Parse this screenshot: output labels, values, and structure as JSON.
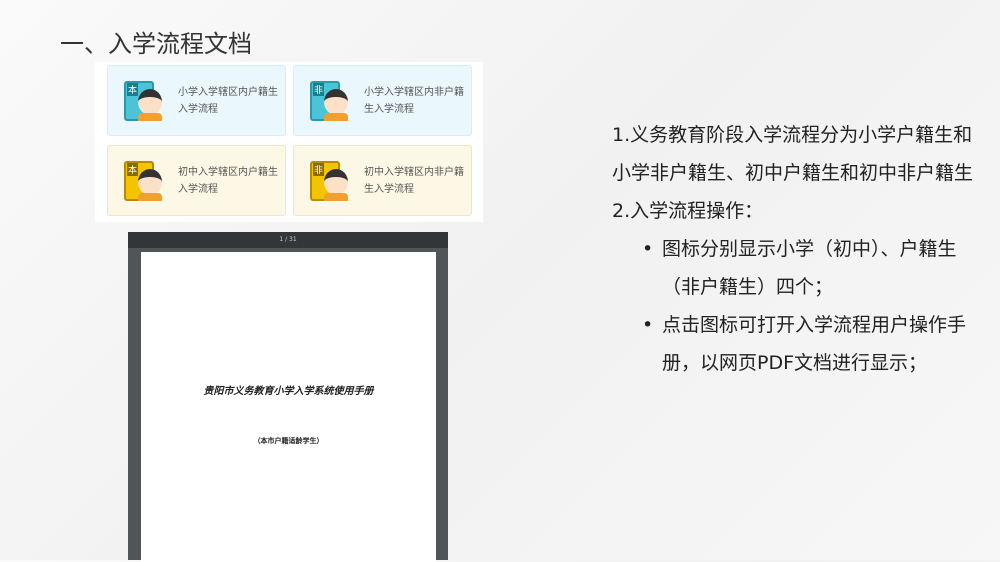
{
  "title": "一、入学流程文档",
  "cards": [
    {
      "label": "小学入学辖区内户籍生入学流程",
      "badge": "本",
      "color": "blue"
    },
    {
      "label": "小学入学辖区内非户籍生入学流程",
      "badge": "非",
      "color": "blue"
    },
    {
      "label": "初中入学辖区内户籍生入学流程",
      "badge": "本",
      "color": "yellow"
    },
    {
      "label": "初中入学辖区内非户籍生入学流程",
      "badge": "非",
      "color": "yellow"
    }
  ],
  "pdf": {
    "page_indicator": "1 / 31",
    "doc_title": "贵阳市义务教育小学入学系统使用手册",
    "doc_subtitle": "（本市户籍适龄学生）"
  },
  "notes": {
    "p1": "1.义务教育阶段入学流程分为小学户籍生和小学非户籍生、初中户籍生和初中非户籍生",
    "p2": "2.入学流程操作：",
    "bullets": [
      "图标分别显示小学（初中）、户籍生（非户籍生）四个；",
      "点击图标可打开入学流程用户操作手册，以网页PDF文档进行显示；"
    ]
  }
}
